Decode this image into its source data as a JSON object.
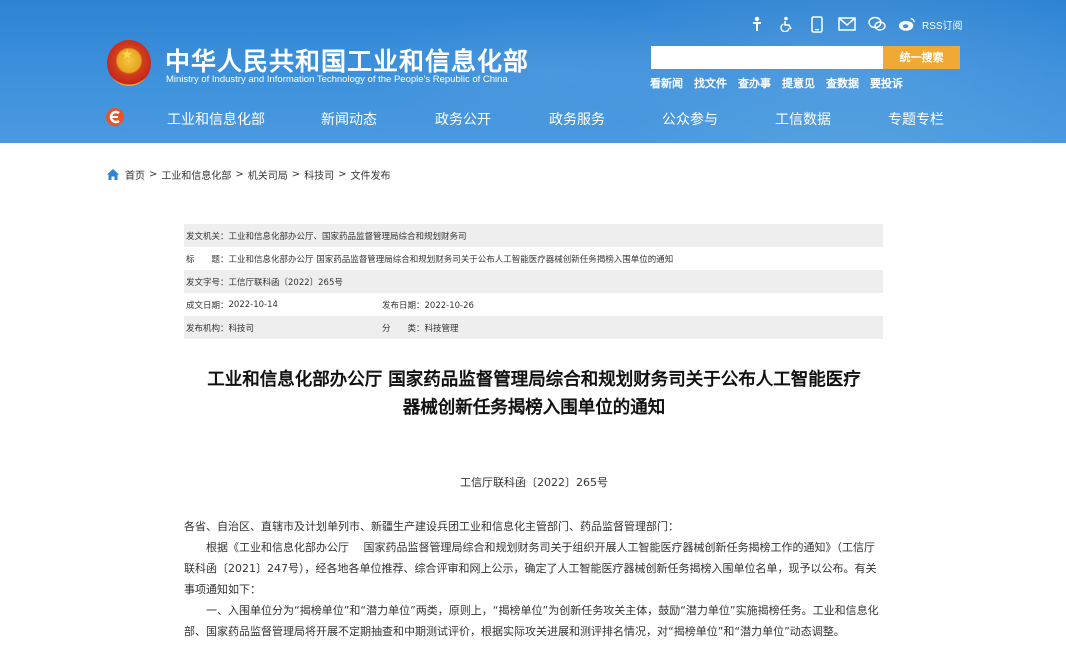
{
  "header": {
    "title": "中华人民共和国工业和信息化部",
    "subtitle": "Ministry of Industry and Information Technology of the People's Republic of China",
    "rss_label": "RSS订阅",
    "search": {
      "placeholder": "",
      "button_label": "统一搜索"
    },
    "quick_links": [
      "看新闻",
      "找文件",
      "查办事",
      "提意见",
      "查数据",
      "要投诉"
    ],
    "icons": [
      "accessibility-icon",
      "wheelchair-icon",
      "mobile-icon",
      "mail-icon",
      "wechat-icon",
      "weibo-icon"
    ]
  },
  "nav": {
    "items": [
      "工业和信息化部",
      "新闻动态",
      "政务公开",
      "政务服务",
      "公众参与",
      "工信数据",
      "专题专栏"
    ]
  },
  "breadcrumb": [
    "首页",
    "工业和信息化部",
    "机关司局",
    "科技司",
    "文件发布"
  ],
  "info": {
    "issuer_label": "发文机关：",
    "issuer": "工业和信息化部办公厅、国家药品监督管理局综合和规划财务司",
    "subject_label": "标　　题：",
    "subject": "工业和信息化部办公厅 国家药品监督管理局综合和规划财务司关于公布人工智能医疗器械创新任务揭榜入围单位的通知",
    "docno_label": "发文字号：",
    "docno": "工信厅联科函〔2022〕265号",
    "created_label": "成文日期：",
    "created": "2022-10-14",
    "published_label": "发布日期：",
    "published": "2022-10-26",
    "org_label": "发布机构：",
    "org": "科技司",
    "category_label": "分　　类：",
    "category": "科技管理"
  },
  "document": {
    "title_line1": "工业和信息化部办公厅 国家药品监督管理局综合和规划财务司关于公布人工智能医疗",
    "title_line2": "器械创新任务揭榜入围单位的通知",
    "number": "工信厅联科函〔2022〕265号",
    "salutation": "各省、自治区、直辖市及计划单列市、新疆生产建设兵团工业和信息化主管部门、药品监督管理部门：",
    "para1": "根据《工业和信息化部办公厅　 国家药品监督管理局综合和规划财务司关于组织开展人工智能医疗器械创新任务揭榜工作的通知》（工信厅联科函〔2021〕247号），经各地各单位推荐、综合评审和网上公示，确定了人工智能医疗器械创新任务揭榜入围单位名单，现予以公布。有关事项通知如下：",
    "para2": "一、入围单位分为“揭榜单位”和“潜力单位”两类，原则上，“揭榜单位”为创新任务攻关主体，鼓励“潜力单位”实施揭榜任务。工业和信息化部、国家药品监督管理局将开展不定期抽查和中期测试评价，根据实际攻关进展和测评排名情况，对“揭榜单位”和“潜力单位”动态调整。"
  }
}
